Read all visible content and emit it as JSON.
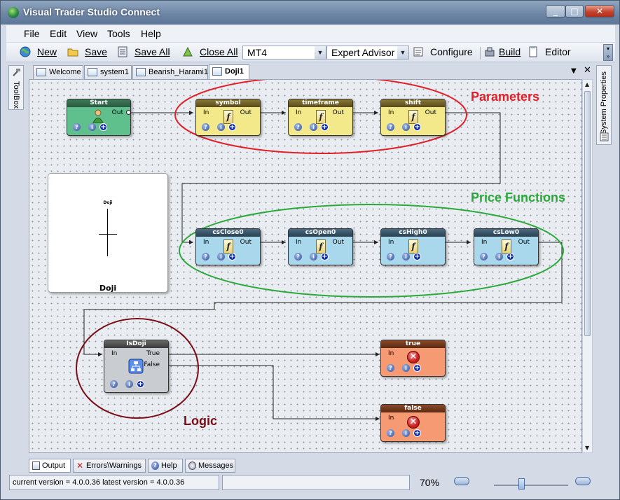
{
  "window": {
    "title": "Visual Trader Studio Connect"
  },
  "menu": [
    "File",
    "Edit",
    "View",
    "Tools",
    "Help"
  ],
  "toolbar": {
    "new": "New",
    "save": "Save",
    "save_all": "Save All",
    "close_all": "Close All",
    "platform": "MT4",
    "type": "Expert Advisor",
    "configure": "Configure",
    "build": "Build",
    "editor": "Editor"
  },
  "side": {
    "toolbox": "ToolBox",
    "system_properties": "System Properties"
  },
  "tabs": [
    "Welcome",
    "system1",
    "Bearish_Harami1",
    "Doji1"
  ],
  "active_tab": "Doji1",
  "annotations": {
    "parameters": "Parameters",
    "price_functions": "Price Functions",
    "logic": "Logic"
  },
  "preview": {
    "small_label": "Doji",
    "label": "Doji"
  },
  "nodes": {
    "start": {
      "title": "Start",
      "out": "Out"
    },
    "symbol": {
      "title": "symbol",
      "in": "In",
      "out": "Out"
    },
    "timeframe": {
      "title": "timeframe",
      "in": "In",
      "out": "Out"
    },
    "shift": {
      "title": "shift",
      "in": "In",
      "out": "Out"
    },
    "csclose0": {
      "title": "csClose0",
      "in": "In",
      "out": "Out"
    },
    "csopen0": {
      "title": "csOpen0",
      "in": "In",
      "out": "Out"
    },
    "cshigh0": {
      "title": "csHigh0",
      "in": "In",
      "out": "Out"
    },
    "cslow0": {
      "title": "csLow0",
      "in": "In",
      "out": "Out"
    },
    "isdoji": {
      "title": "IsDoji",
      "in": "In",
      "true": "True",
      "false": "False"
    },
    "true_node": {
      "title": "true",
      "in": "In"
    },
    "false_node": {
      "title": "false",
      "in": "In"
    }
  },
  "bottom_tabs": [
    "Output",
    "Errors\\Warnings",
    "Help",
    "Messages"
  ],
  "status": {
    "version": "current version = 4.0.0.36 latest version = 4.0.0.36",
    "zoom": "70%"
  },
  "colors": {
    "param": "#f4e98a",
    "price": "#a9d8ec",
    "logic": "#c9ccd1",
    "result": "#f59a72",
    "start": "#5fc08e",
    "red": "#e0212a",
    "green": "#2aa839",
    "maroon": "#7a0e16"
  }
}
